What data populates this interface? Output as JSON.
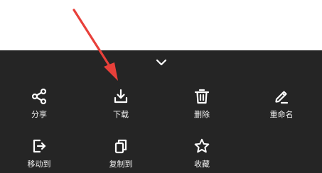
{
  "colors": {
    "sheet_background": "#252525",
    "icon": "#ffffff",
    "label": "#f2f2f2",
    "annotation_arrow": "#e8403a"
  },
  "sheet": {
    "collapse_icon": "chevron-down-icon",
    "actions": [
      {
        "id": "share",
        "label": "分享",
        "icon": "share-icon"
      },
      {
        "id": "download",
        "label": "下载",
        "icon": "download-icon"
      },
      {
        "id": "delete",
        "label": "删除",
        "icon": "trash-icon"
      },
      {
        "id": "rename",
        "label": "重命名",
        "icon": "pencil-icon"
      },
      {
        "id": "move",
        "label": "移动到",
        "icon": "move-to-icon"
      },
      {
        "id": "copy",
        "label": "复制到",
        "icon": "copy-icon"
      },
      {
        "id": "favorite",
        "label": "收藏",
        "icon": "star-icon"
      }
    ]
  },
  "annotation": {
    "type": "red-arrow",
    "points_to": "download"
  }
}
